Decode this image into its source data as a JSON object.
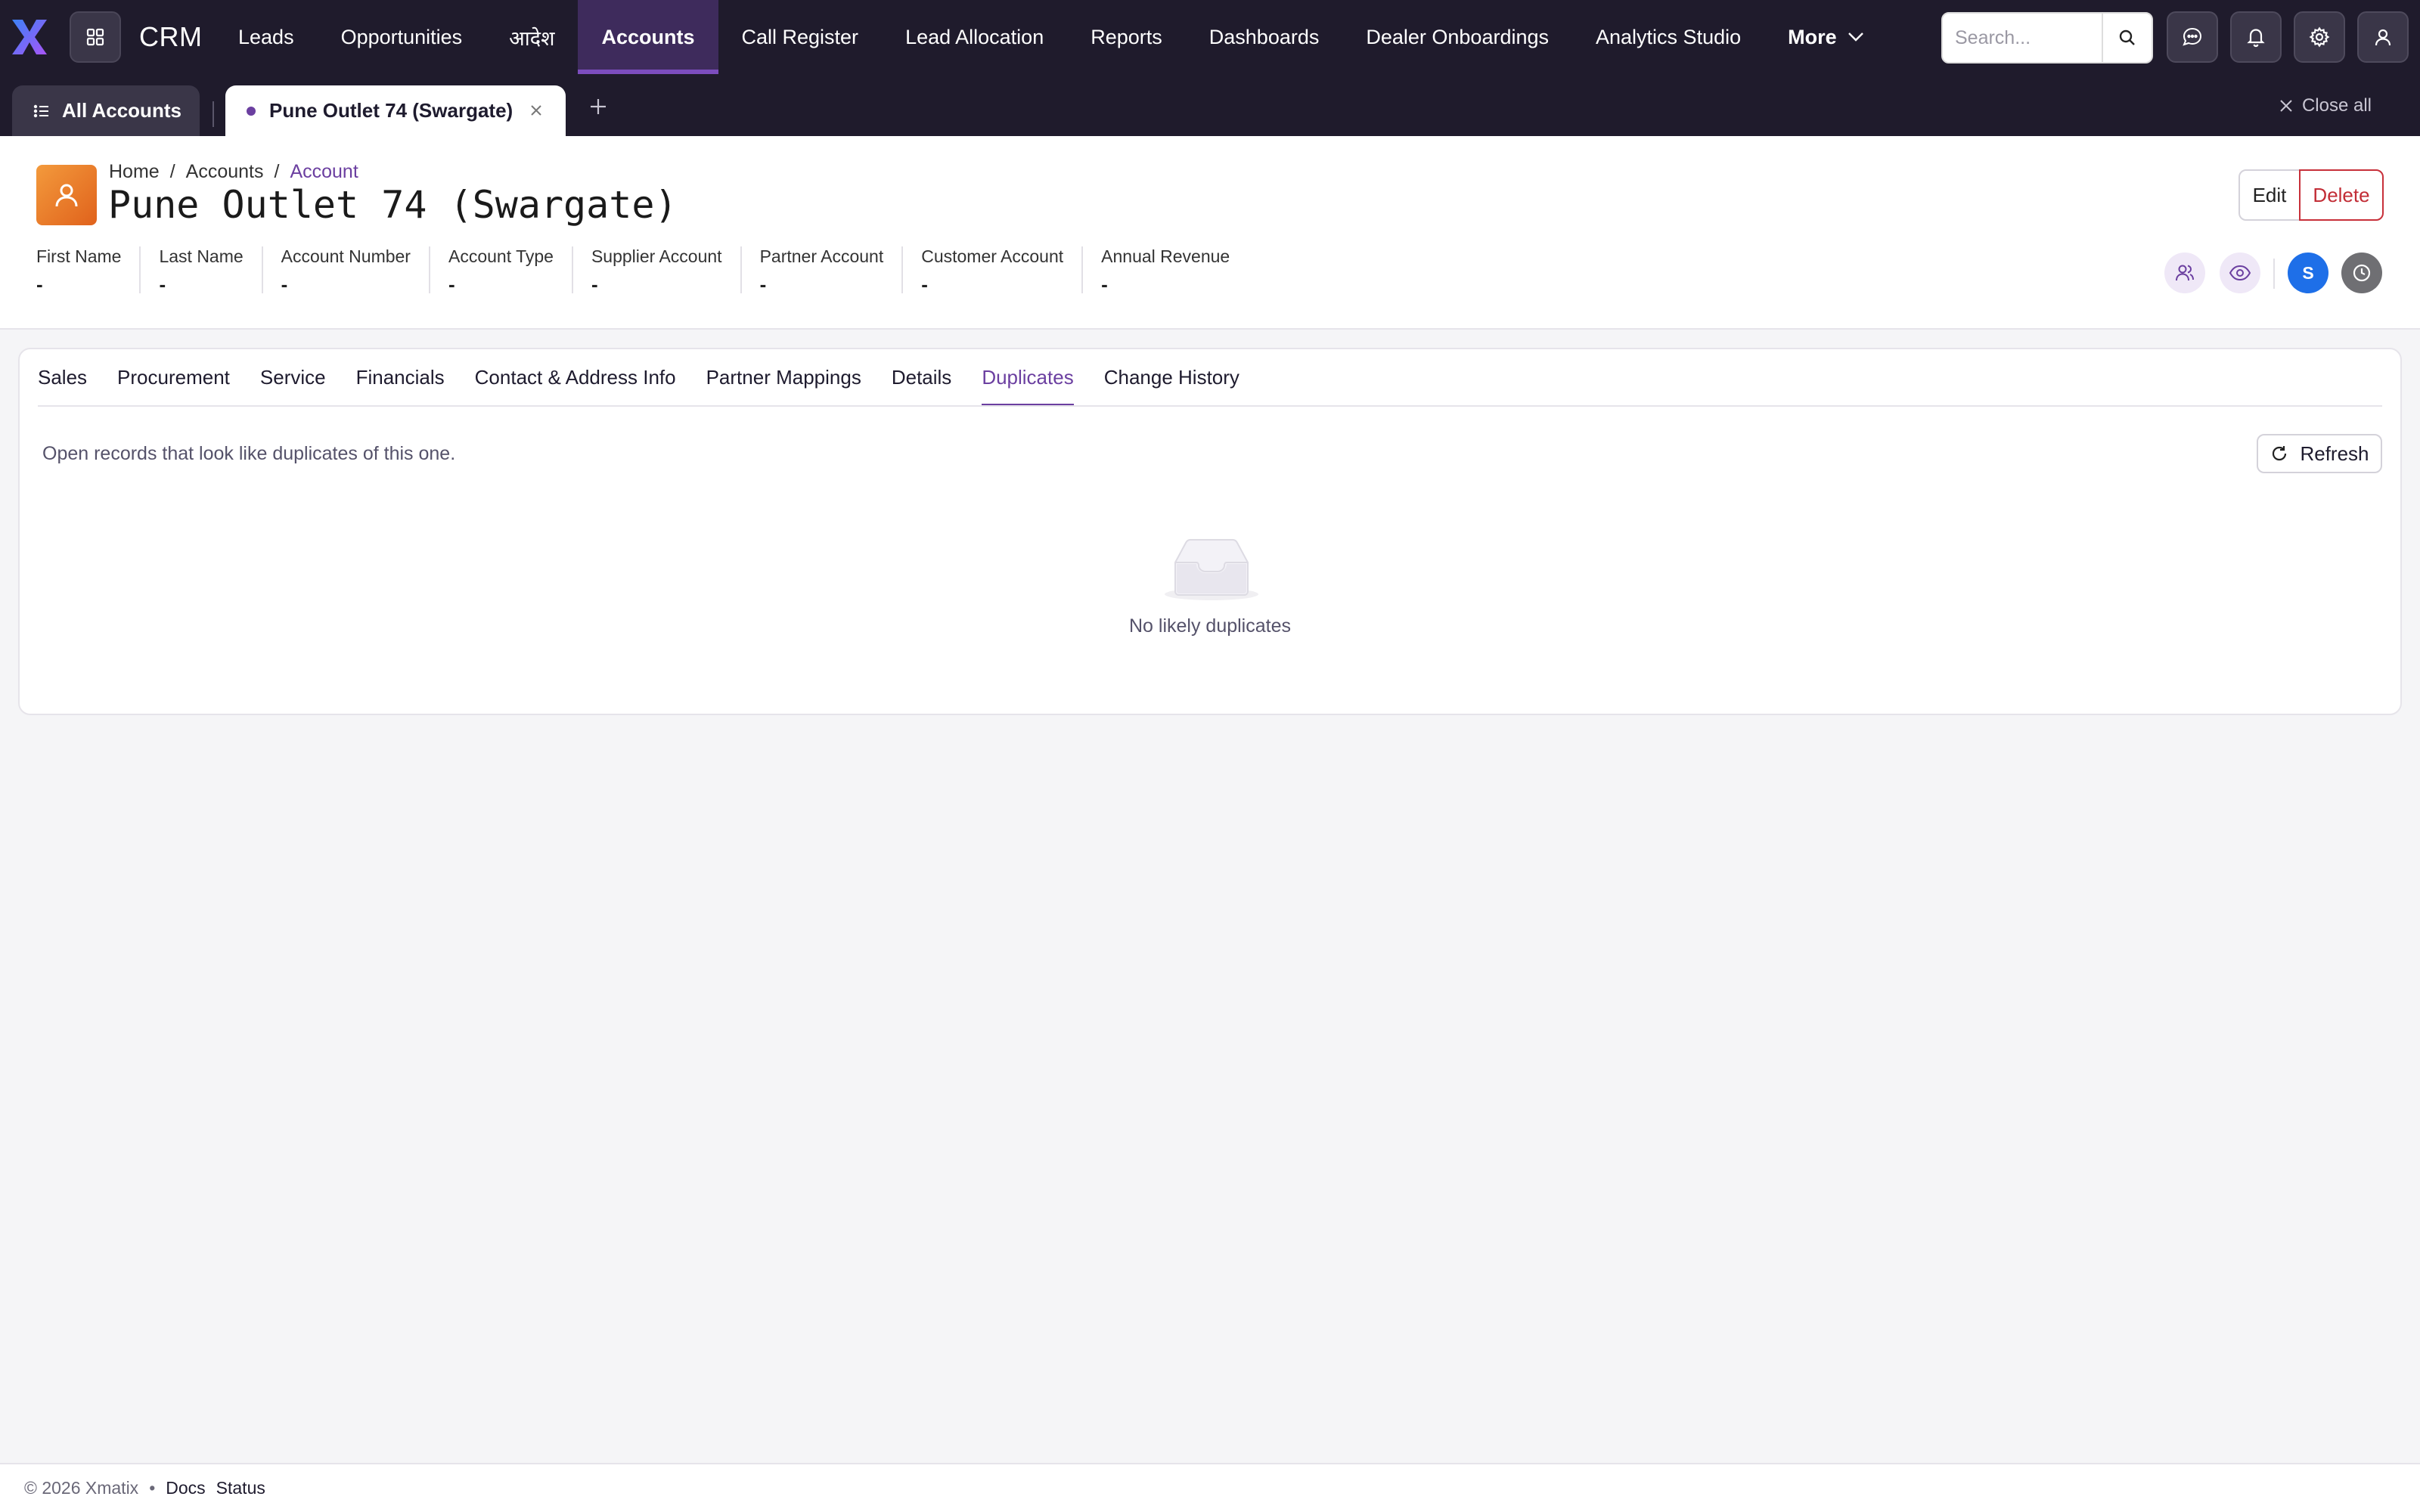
{
  "app": {
    "brand": "CRM",
    "logo": "x-logo",
    "apps_icon": "grid-icon"
  },
  "nav": {
    "items": [
      {
        "label": "Leads",
        "active": false
      },
      {
        "label": "Opportunities",
        "active": false
      },
      {
        "label": "आदेश",
        "active": false
      },
      {
        "label": "Accounts",
        "active": true
      },
      {
        "label": "Call Register",
        "active": false
      },
      {
        "label": "Lead Allocation",
        "active": false
      },
      {
        "label": "Reports",
        "active": false
      },
      {
        "label": "Dashboards",
        "active": false
      },
      {
        "label": "Dealer Onboardings",
        "active": false
      },
      {
        "label": "Analytics Studio",
        "active": false
      }
    ],
    "more_label": "More"
  },
  "search": {
    "placeholder": "Search..."
  },
  "tabs": {
    "all_label": "All Accounts",
    "current_label": "Pune Outlet 74 (Swargate)",
    "close_all_label": "Close all"
  },
  "breadcrumb": {
    "home": "Home",
    "accounts": "Accounts",
    "current": "Account",
    "sep": "/"
  },
  "record": {
    "title": "Pune Outlet 74 (Swargate)",
    "fields": [
      {
        "label": "First Name",
        "value": "-"
      },
      {
        "label": "Last Name",
        "value": "-"
      },
      {
        "label": "Account Number",
        "value": "-"
      },
      {
        "label": "Account Type",
        "value": "-"
      },
      {
        "label": "Supplier Account",
        "value": "-"
      },
      {
        "label": "Partner Account",
        "value": "-"
      },
      {
        "label": "Customer Account",
        "value": "-"
      },
      {
        "label": "Annual Revenue",
        "value": "-"
      }
    ],
    "user_initial": "S"
  },
  "actions": {
    "edit_label": "Edit",
    "delete_label": "Delete"
  },
  "content_tabs": [
    {
      "label": "Sales",
      "active": false
    },
    {
      "label": "Procurement",
      "active": false
    },
    {
      "label": "Service",
      "active": false
    },
    {
      "label": "Financials",
      "active": false
    },
    {
      "label": "Contact & Address Info",
      "active": false
    },
    {
      "label": "Partner Mappings",
      "active": false
    },
    {
      "label": "Details",
      "active": false
    },
    {
      "label": "Duplicates",
      "active": true
    },
    {
      "label": "Change History",
      "active": false
    }
  ],
  "duplicates": {
    "description": "Open records that look like duplicates of this one.",
    "refresh_label": "Refresh",
    "empty_text": "No likely duplicates"
  },
  "footer": {
    "copyright": "© 2026 Xmatix",
    "sep": "•",
    "docs": "Docs",
    "status": "Status"
  },
  "colors": {
    "accent": "#6b3fa0",
    "topbar": "#1f1b2c",
    "danger": "#c22d36",
    "avatar": "#e8772a",
    "user_badge": "#1e6fe8"
  }
}
